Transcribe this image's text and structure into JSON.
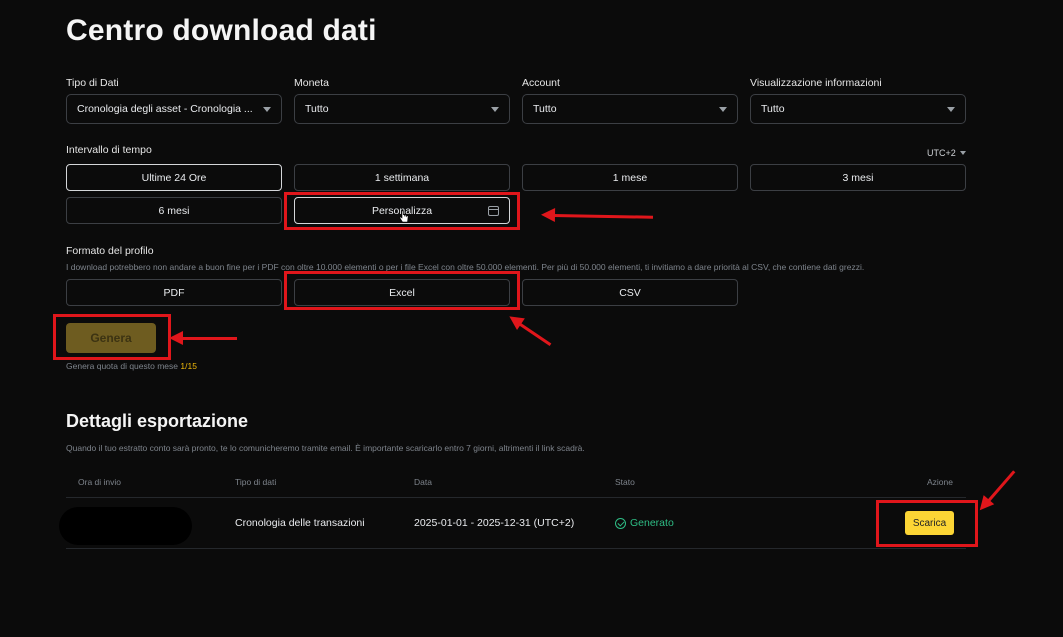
{
  "page": {
    "title": "Centro download dati"
  },
  "filters": {
    "data_type": {
      "label": "Tipo di Dati",
      "value": "Cronologia degli asset - Cronologia ..."
    },
    "currency": {
      "label": "Moneta",
      "value": "Tutto"
    },
    "account": {
      "label": "Account",
      "value": "Tutto"
    },
    "display": {
      "label": "Visualizzazione informazioni",
      "value": "Tutto"
    }
  },
  "time_range": {
    "label": "Intervallo di tempo",
    "timezone": "UTC+2",
    "options": [
      "Ultime 24 Ore",
      "1 settimana",
      "1 mese",
      "3 mesi",
      "6 mesi",
      "Personalizza"
    ],
    "active_index": 0
  },
  "format": {
    "label": "Formato del profilo",
    "note": "I download potrebbero non andare a buon fine per i PDF con oltre 10.000 elementi o per i file Excel con oltre 50.000 elementi. Per più di 50.000 elementi, ti invitiamo a dare priorità al CSV, che contiene dati grezzi.",
    "options": [
      "PDF",
      "Excel",
      "CSV"
    ]
  },
  "generate": {
    "label": "Genera",
    "quota_label": "Genera quota di questo mese",
    "quota_value": "1/15"
  },
  "export": {
    "title": "Dettagli esportazione",
    "note": "Quando il tuo estratto conto sarà pronto, te lo comunicheremo tramite email. È importante scaricarlo entro 7 giorni, altrimenti il link scadrà.",
    "columns": [
      "Ora di invio",
      "Tipo di dati",
      "Data",
      "Stato",
      "Azione"
    ],
    "rows": [
      {
        "type": "Cronologia delle transazioni",
        "date": "2025-01-01 - 2025-12-31 (UTC+2)",
        "status": "Generato",
        "action": "Scarica"
      }
    ]
  },
  "colors": {
    "accent": "#fcd535",
    "success": "#2ebd85",
    "annotation": "#e0161b"
  },
  "icons": [
    "chevron-down-icon",
    "calendar-icon",
    "check-circle-icon",
    "pointer-cursor-icon"
  ]
}
